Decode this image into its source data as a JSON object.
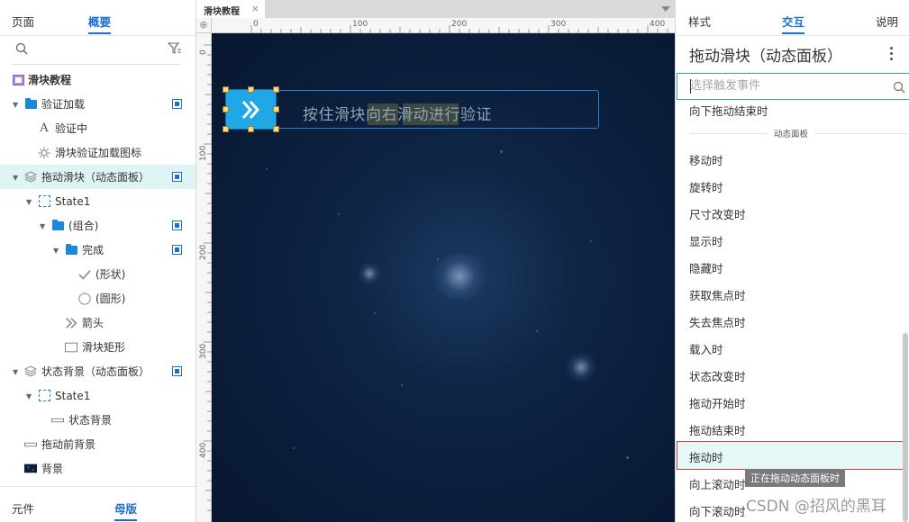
{
  "left_panel": {
    "tabs": [
      "页面",
      "概要"
    ],
    "tree": [
      {
        "label": "滑块教程",
        "icon": "page-icon",
        "level": 0,
        "bold": true
      },
      {
        "label": "验证加载",
        "icon": "folder-icon",
        "level": 0,
        "arrow": true,
        "visible": true
      },
      {
        "label": "验证中",
        "icon": "text-icon",
        "level": 1
      },
      {
        "label": "滑块验证加载图标",
        "icon": "loading-gear-icon",
        "level": 1
      },
      {
        "label": "拖动滑块（动态面板）",
        "icon": "layers-icon",
        "level": 0,
        "arrow": true,
        "visible": true,
        "selected": true
      },
      {
        "label": "State1",
        "icon": "state-icon",
        "level": 1,
        "arrow": true
      },
      {
        "label": "(组合)",
        "icon": "folder-icon",
        "level": 2,
        "arrow": true,
        "visible": true
      },
      {
        "label": "完成",
        "icon": "folder-icon",
        "level": 3,
        "arrow": true,
        "visible": true
      },
      {
        "label": "(形状)",
        "icon": "check-shape-icon",
        "level": 4
      },
      {
        "label": "(圆形)",
        "icon": "circle-icon",
        "level": 4
      },
      {
        "label": "箭头",
        "icon": "double-chevron-icon",
        "level": 3
      },
      {
        "label": "滑块矩形",
        "icon": "rectangle-icon",
        "level": 3
      },
      {
        "label": "状态背景（动态面板）",
        "icon": "layers-icon",
        "level": 0,
        "arrow": true,
        "visible": true
      },
      {
        "label": "State1",
        "icon": "state-icon",
        "level": 1,
        "arrow": true
      },
      {
        "label": "状态背景",
        "icon": "thin-bar-icon",
        "level": 2
      },
      {
        "label": "拖动前背景",
        "icon": "thin-bar-icon",
        "level": 0
      },
      {
        "label": "背景",
        "icon": "image-icon",
        "level": 0
      }
    ],
    "bottom_tabs": [
      "元件",
      "母版"
    ]
  },
  "canvas": {
    "tab_label": "滑块教程",
    "tab_close": "×",
    "corner_icon": "crosshair-icon",
    "h_ruler": [
      "0",
      "100",
      "200",
      "300",
      "400"
    ],
    "v_ruler": [
      "0",
      "100",
      "200",
      "300",
      "400"
    ],
    "slider_text": "按住滑块向右滑动进行验证",
    "background_color": "#0b1e3b",
    "slider_color": "#1fa7e6"
  },
  "right_panel": {
    "tabs": [
      "样式",
      "交互",
      "说明"
    ],
    "title": "拖动滑块（动态面板）",
    "search_placeholder": "选择触发事件",
    "partial_event": "向下拖动结束时",
    "group_label": "动态面板",
    "events": [
      "移动时",
      "旋转时",
      "尺寸改变时",
      "显示时",
      "隐藏时",
      "获取焦点时",
      "失去焦点时",
      "载入时",
      "状态改变时",
      "拖动开始时",
      "拖动结束时",
      "拖动时",
      "向上滚动时",
      "向下滚动时"
    ],
    "highlighted_event": "拖动时",
    "tooltip": "正在拖动动态面板时",
    "watermark": "CSDN @招风的黑耳",
    "accent_color": "#1b6fd1"
  }
}
